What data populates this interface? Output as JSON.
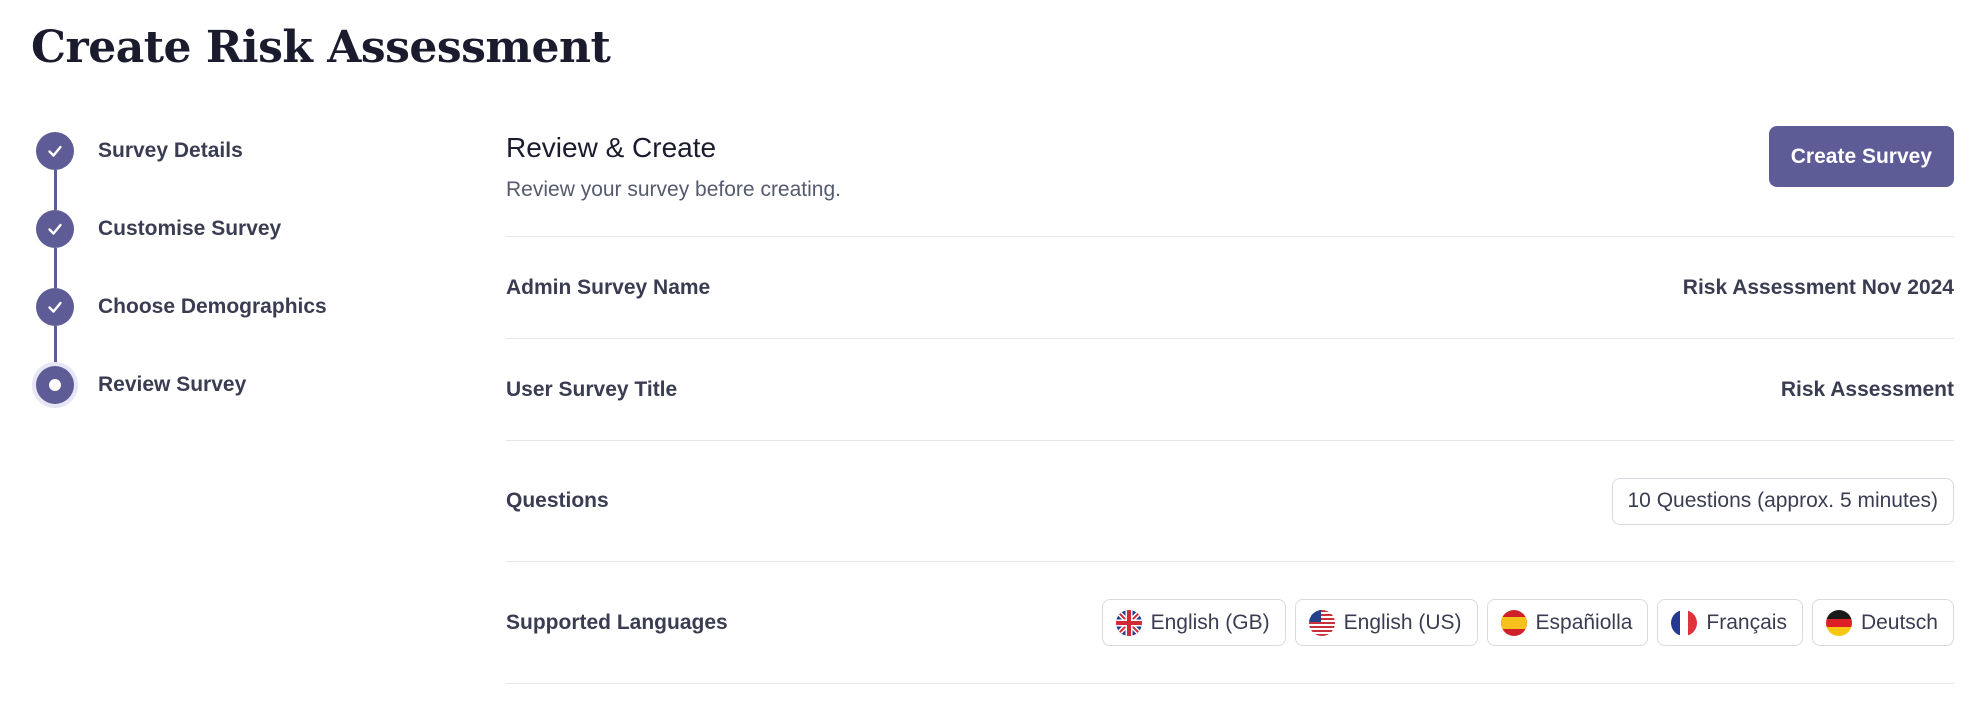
{
  "page": {
    "title": "Create Risk Assessment"
  },
  "stepper": {
    "steps": [
      {
        "label": "Survey Details",
        "status": "complete"
      },
      {
        "label": "Customise Survey",
        "status": "complete"
      },
      {
        "label": "Choose Demographics",
        "status": "complete"
      },
      {
        "label": "Review Survey",
        "status": "current"
      }
    ]
  },
  "review": {
    "title": "Review & Create",
    "subtitle": "Review your survey before creating.",
    "create_button": "Create Survey",
    "rows": {
      "admin_name": {
        "label": "Admin Survey Name",
        "value": "Risk Assessment Nov 2024"
      },
      "user_title": {
        "label": "User Survey Title",
        "value": "Risk Assessment"
      },
      "questions": {
        "label": "Questions",
        "value": "10 Questions (approx. 5 minutes)"
      },
      "languages": {
        "label": "Supported Languages",
        "items": [
          {
            "label": "English (GB)",
            "icon": "uk-flag-icon"
          },
          {
            "label": "English (US)",
            "icon": "us-flag-icon"
          },
          {
            "label": "Españiolla",
            "icon": "spain-flag-icon"
          },
          {
            "label": "Français",
            "icon": "france-flag-icon"
          },
          {
            "label": "Deutsch",
            "icon": "germany-flag-icon"
          }
        ]
      }
    }
  },
  "colors": {
    "accent": "#5e5c96",
    "current_step_halo": "#e7e6f6",
    "divider": "#e6e6ec"
  }
}
